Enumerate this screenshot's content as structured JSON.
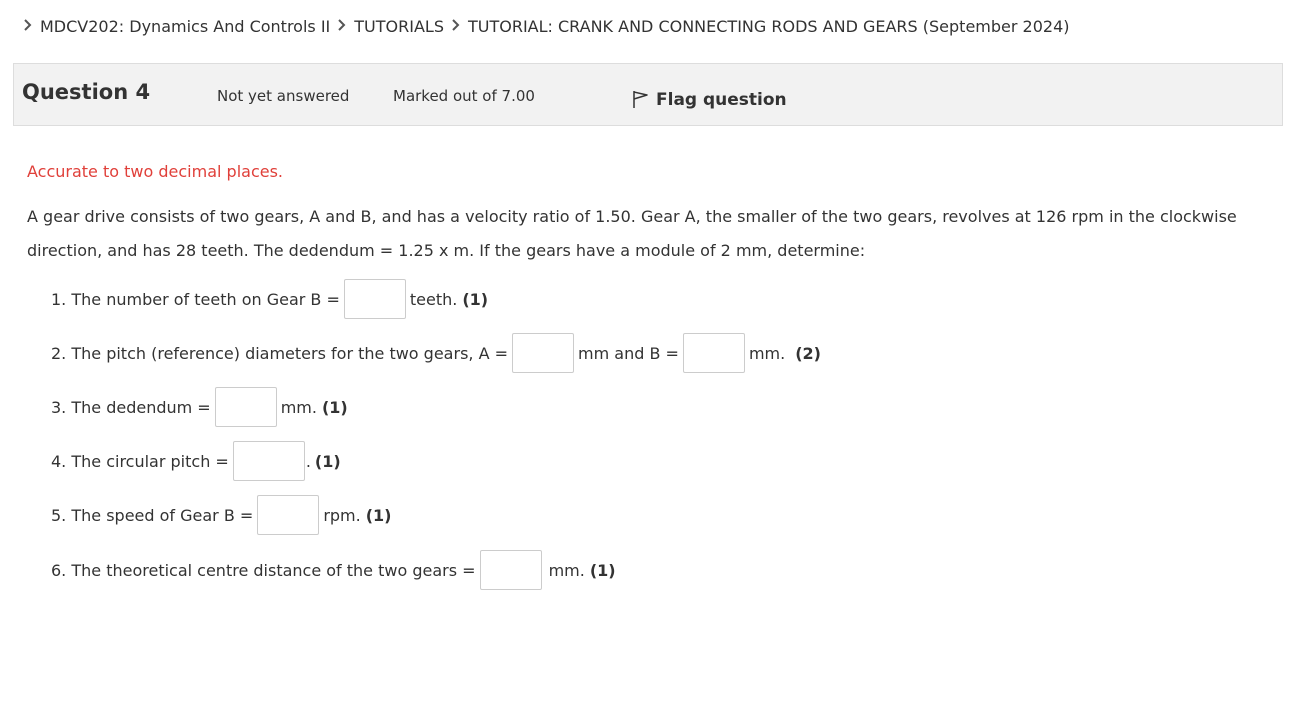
{
  "breadcrumb": [
    {
      "label": "MDCV202: Dynamics And Controls II"
    },
    {
      "label": "TUTORIALS"
    },
    {
      "label": "TUTORIAL: CRANK AND CONNECTING RODS AND GEARS (September 2024)"
    }
  ],
  "question": {
    "title": "Question 4",
    "state": "Not yet answered",
    "grade": "Marked out of 7.00",
    "flag_label": "Flag question"
  },
  "note": "Accurate to two decimal places.",
  "text": "A gear drive consists of two gears, A and B, and has a velocity ratio of 1.50. Gear A, the smaller of the two gears, revolves at 126 rpm in the clockwise direction, and has 28 teeth. The dedendum = 1.25 x m. If the gears have a module of 2 mm, determine:",
  "parts": {
    "p1": {
      "prefix": "1. The number of teeth on Gear B =",
      "suffix": "teeth.",
      "marks": "(1)",
      "value": ""
    },
    "p2": {
      "prefix": "2. The pitch (reference) diameters for the two gears, A =",
      "mid": "mm and B =",
      "suffix": "mm.",
      "marks": "(2)",
      "value_a": "",
      "value_b": ""
    },
    "p3": {
      "prefix": "3. The dedendum =",
      "suffix": "mm.",
      "marks": "(1)",
      "value": ""
    },
    "p4": {
      "prefix": "4. The circular pitch =",
      "suffix": ".",
      "marks": "(1)",
      "value": ""
    },
    "p5": {
      "prefix": "5. The speed of Gear B =",
      "suffix": "rpm.",
      "marks": "(1)",
      "value": ""
    },
    "p6": {
      "prefix": "6. The theoretical centre distance of the two gears =",
      "suffix": "mm.",
      "marks": "(1)",
      "value": ""
    }
  },
  "icons": {
    "breadcrumb_separator": "chevron-right-icon",
    "flag": "flag-icon"
  }
}
